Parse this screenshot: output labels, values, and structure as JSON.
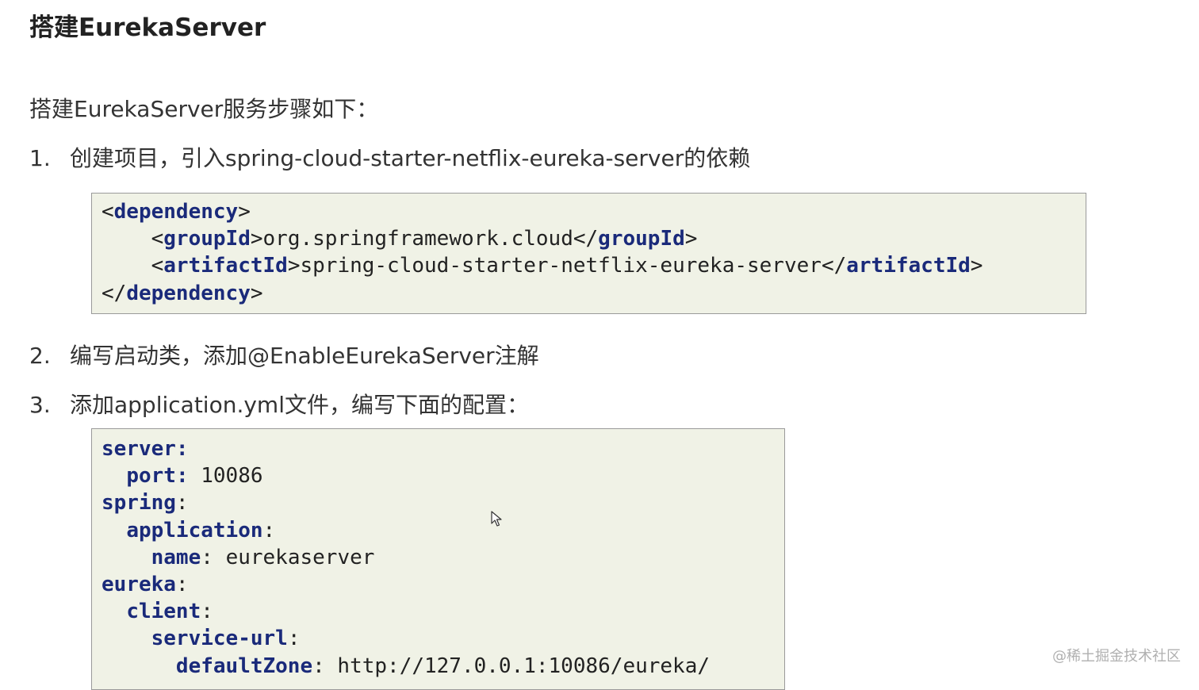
{
  "title": "搭建EurekaServer",
  "intro": "搭建EurekaServer服务步骤如下：",
  "steps": [
    {
      "num": "1.",
      "text": "创建项目，引入spring-cloud-starter-netflix-eureka-server的依赖"
    },
    {
      "num": "2.",
      "text": "编写启动类，添加@EnableEurekaServer注解"
    },
    {
      "num": "3.",
      "text": "添加application.yml文件，编写下面的配置："
    }
  ],
  "xml": {
    "dependency_tag": "dependency",
    "groupId_tag": "groupId",
    "groupId_value": "org.springframework.cloud",
    "artifactId_tag": "artifactId",
    "artifactId_value": "spring-cloud-starter-netflix-eureka-server"
  },
  "yaml": {
    "server_key": "server",
    "port_key": "port",
    "port_value": "10086",
    "spring_key": "spring",
    "application_key": "application",
    "name_key": "name",
    "name_value": "eurekaserver",
    "eureka_key": "eureka",
    "client_key": "client",
    "service_url_key": "service-url",
    "default_zone_key": "defaultZone",
    "default_zone_value": "http://127.0.0.1:10086/eureka/"
  },
  "watermark": "@稀土掘金技术社区",
  "colors": {
    "code_background": "#f0f2e6",
    "keyword": "#1a2a7a"
  }
}
